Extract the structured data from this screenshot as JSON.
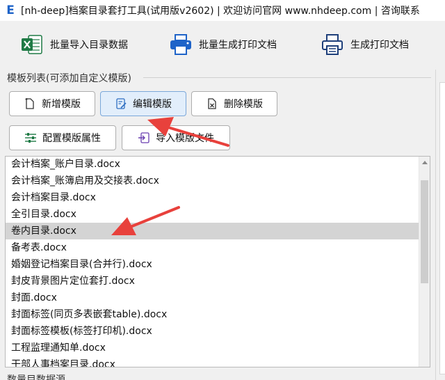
{
  "window": {
    "app_icon_letter": "E",
    "title": "[nh-deep]档案目录套打工具(试用版v2602) | 欢迎访问官网 www.nhdeep.com | 咨询联系"
  },
  "toolbar": {
    "import_label": "批量导入目录数据",
    "batch_print_label": "批量生成打印文档",
    "print_label": "生成打印文档"
  },
  "template_group": {
    "title": "模板列表(可添加自定义模版)",
    "add_label": "新增模版",
    "edit_label": "编辑模版",
    "delete_label": "删除模版",
    "config_label": "配置模版属性",
    "import_label": "导入模版文件"
  },
  "template_list": {
    "selected_index": 4,
    "items": [
      "会计档案_账户目录.docx",
      "会计档案_账簿启用及交接表.docx",
      "会计档案目录.docx",
      "全引目录.docx",
      "卷内目录.docx",
      "备考表.docx",
      "婚姻登记档案目录(合并行).docx",
      "封皮背景图片定位套打.docx",
      "封面.docx",
      "封面标签(同页多表嵌套table).docx",
      "封面标签模板(标签打印机).docx",
      "工程监理通知单.docx",
      "干部人事档案目录.docx"
    ]
  },
  "bottom": {
    "partial_label": "数量目数据源"
  },
  "colors": {
    "accent_blue": "#1e63c8",
    "annotation_red": "#e8413c",
    "selected_row": "#d4d4d4"
  },
  "icons": {
    "excel": "excel-icon",
    "printer": "printer-icon",
    "new": "new-file-icon",
    "edit": "edit-icon",
    "delete": "delete-file-icon",
    "config": "sliders-icon",
    "import": "import-icon"
  }
}
